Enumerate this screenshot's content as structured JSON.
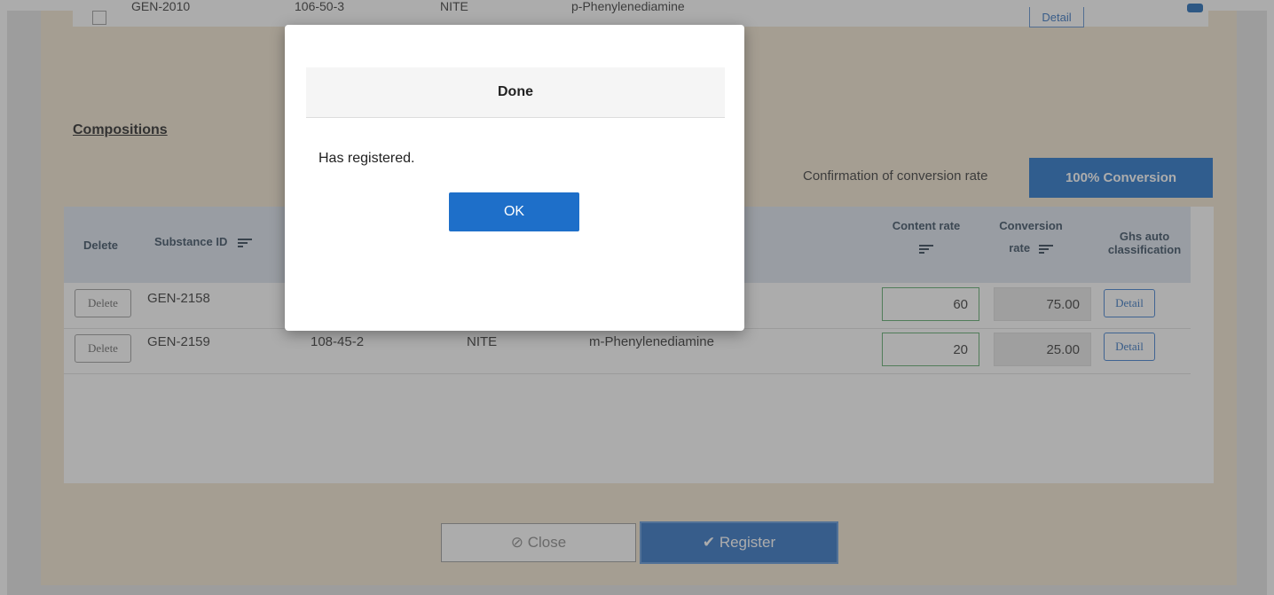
{
  "top_row": {
    "substance_id": "GEN-2010",
    "cas": "106-50-3",
    "source": "NITE",
    "name": "p-Phenylenediamine",
    "detail_label": "Detail"
  },
  "section_title": "Compositions",
  "conversion": {
    "label": "Confirmation of conversion rate",
    "button": "100% Conversion"
  },
  "table": {
    "headers": {
      "delete": "Delete",
      "substance_id": "Substance ID",
      "content_rate": "Content rate",
      "conversion_rate_1": "Conversion",
      "conversion_rate_2": "rate",
      "ghs_1": "Ghs auto",
      "ghs_2": "classification"
    },
    "rows": [
      {
        "delete": "Delete",
        "substance_id": "GEN-2158",
        "cas": "",
        "source": "",
        "name": "",
        "content_rate": "60",
        "conversion_rate": "75.00",
        "detail": "Detail"
      },
      {
        "delete": "Delete",
        "substance_id": "GEN-2159",
        "cas": "108-45-2",
        "source": "NITE",
        "name": "m-Phenylenediamine",
        "content_rate": "20",
        "conversion_rate": "25.00",
        "detail": "Detail"
      }
    ]
  },
  "footer": {
    "close_label": "Close",
    "register_label": "Register"
  },
  "modal": {
    "title": "Done",
    "message": "Has registered.",
    "ok_label": "OK"
  },
  "colors": {
    "primary": "#1e6fc9",
    "panel_bg": "#f3e6d0",
    "header_bg": "#dce3ee"
  }
}
